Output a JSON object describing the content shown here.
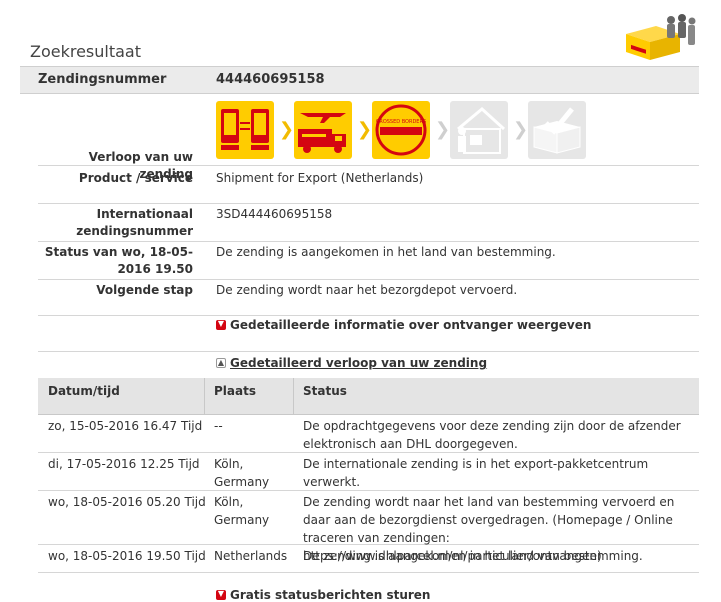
{
  "page": {
    "title": "Zoekresultaat"
  },
  "header": {
    "label": "Zendingsnummer",
    "value": "444460695158"
  },
  "progress": {
    "label": "Verloop van uw zending",
    "stamp_text": "CROSSED BORDERS",
    "steps": [
      {
        "icon": "phone-transfer-icon",
        "active": true
      },
      {
        "icon": "plane-truck-icon",
        "active": true
      },
      {
        "icon": "crossed-borders-icon",
        "active": true
      },
      {
        "icon": "house-delivery-icon",
        "active": false
      },
      {
        "icon": "box-check-icon",
        "active": false
      }
    ]
  },
  "details": {
    "product_label": "Product / service",
    "product_value": "Shipment for Export (Netherlands)",
    "intl_label": "Internationaal zendingsnummer",
    "intl_value": "3SD444460695158",
    "status_label": "Status van wo, 18-05-2016 19.50",
    "status_value": "De zending is aangekomen in het land van bestemming.",
    "next_label": "Volgende stap",
    "next_value": "De zending wordt naar het bezorgdepot vervoerd."
  },
  "toggles": {
    "receiver": "Gedetailleerde informatie over ontvanger weergeven",
    "history": "Gedetailleerd verloop van uw zending",
    "notify": "Gratis statusberichten sturen"
  },
  "history": {
    "columns": [
      "Datum/tijd",
      "Plaats",
      "Status"
    ],
    "rows": [
      {
        "date": "zo, 15-05-2016 16.47 Tijd",
        "place": "--",
        "status": "De opdrachtgegevens voor deze zending zijn door de afzender elektronisch aan DHL doorgegeven."
      },
      {
        "date": "di, 17-05-2016 12.25 Tijd",
        "place": "Köln, Germany",
        "status": "De internationale zending is in het export-pakketcentrum verwerkt."
      },
      {
        "date": "wo, 18-05-2016 05.20 Tijd",
        "place": "Köln, Germany",
        "status": "De zending wordt naar het land van bestemming vervoerd en daar aan de bezorgdienst overgedragen. (Homepage / Online traceren van zendingen: https://www.dhlparcel.nl/nl/particulier/ontvangen)"
      },
      {
        "date": "wo, 18-05-2016 19.50 Tijd",
        "place": "Netherlands",
        "status": "De zending is aangekomen in het land van bestemming."
      }
    ]
  },
  "colors": {
    "dhl_yellow": "#ffcc00",
    "dhl_red": "#d40511",
    "inactive": "#e6e6e6"
  }
}
